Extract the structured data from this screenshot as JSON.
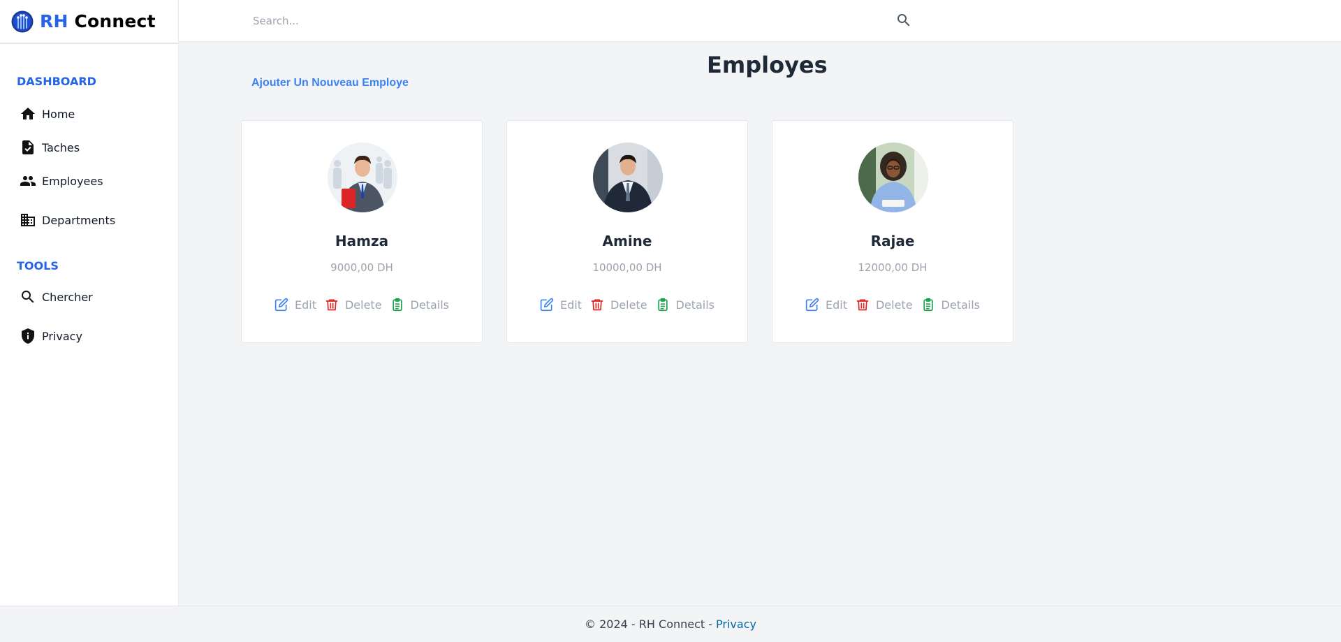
{
  "brand": {
    "prefix": "RH",
    "name": "Connect"
  },
  "sidebar": {
    "dashboard_title": "DASHBOARD",
    "dashboard_items": [
      {
        "label": "Home",
        "icon": "home-icon"
      },
      {
        "label": "Taches",
        "icon": "task-icon"
      },
      {
        "label": "Employees",
        "icon": "people-icon"
      },
      {
        "label": "Departments",
        "icon": "building-icon"
      }
    ],
    "tools_title": "TOOLS",
    "tools_items": [
      {
        "label": "Chercher",
        "icon": "search-icon"
      },
      {
        "label": "Privacy",
        "icon": "shield-icon"
      }
    ]
  },
  "search": {
    "placeholder": "Search..."
  },
  "main": {
    "title": "Employes",
    "add_link": "Ajouter Un Nouveau Employe"
  },
  "employees": [
    {
      "name": "Hamza",
      "salary": "9000,00 DH"
    },
    {
      "name": "Amine",
      "salary": "10000,00 DH"
    },
    {
      "name": "Rajae",
      "salary": "12000,00 DH"
    }
  ],
  "actions": {
    "edit": "Edit",
    "delete": "Delete",
    "details": "Details"
  },
  "footer": {
    "text": "© 2024 - RH Connect -",
    "link": "Privacy"
  },
  "colors": {
    "accent": "#2563eb",
    "edit": "#3b82f6",
    "delete": "#dc2626",
    "details": "#16a34a"
  }
}
